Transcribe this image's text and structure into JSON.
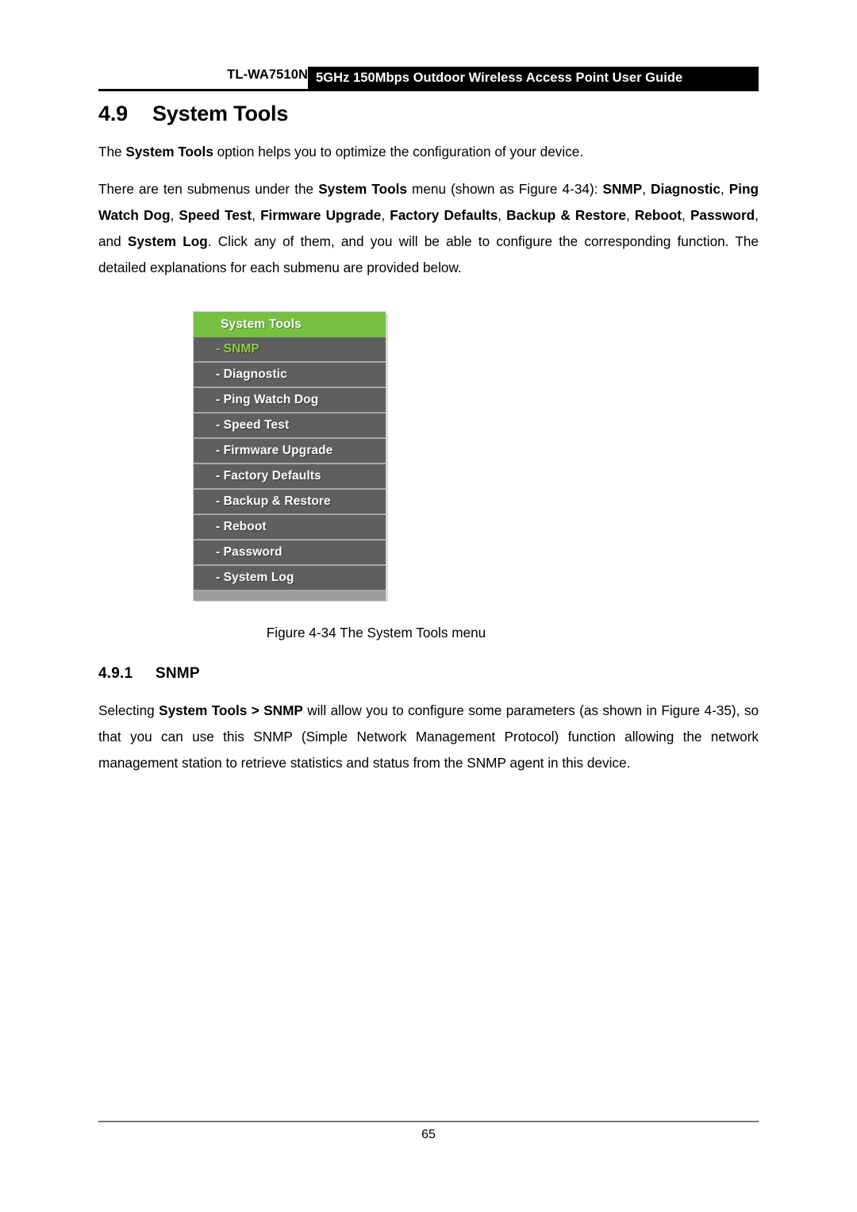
{
  "header": {
    "model": "TL-WA7510N",
    "title": "5GHz 150Mbps Outdoor Wireless Access Point User Guide"
  },
  "section": {
    "number": "4.9",
    "title": "System Tools"
  },
  "subsection": {
    "number": "4.9.1",
    "title": "SNMP"
  },
  "paragraphs": {
    "intro_1": "The ",
    "intro_1_bold": "System Tools",
    "intro_1_tail": " option helps you to optimize the configuration of your device.",
    "intro_2_a": "There are ten submenus under the ",
    "intro_2_b": "System Tools",
    "intro_2_c": " menu (shown as Figure 4-34): ",
    "intro_2_d": "SNMP",
    "intro_2_e": ", ",
    "intro_2_f": "Diagnostic",
    "intro_2_g": ", ",
    "intro_2_h": "Ping Watch Dog",
    "intro_2_i": ", ",
    "intro_2_j": "Speed Test",
    "intro_2_k": ", ",
    "intro_2_l": "Firmware Upgrade",
    "intro_2_m": ", ",
    "intro_2_n": "Factory Defaults",
    "intro_2_o": ", ",
    "intro_2_p": "Backup & Restore",
    "intro_2_q": ", ",
    "intro_2_r": "Reboot",
    "intro_2_s": ", ",
    "intro_2_t": "Password",
    "intro_2_u": ", and ",
    "intro_2_v": "System Log",
    "intro_2_w": ". Click any of them, and you will be able to configure the corresponding function. The detailed explanations for each submenu are provided below.",
    "snmp_a": "Selecting ",
    "snmp_b": "System Tools > SNMP",
    "snmp_c": " will allow you to configure some parameters (as shown in Figure 4-35), so that you can use this SNMP (Simple Network Management Protocol) function allowing the network management station to retrieve statistics and status from the SNMP agent in this device."
  },
  "figure": {
    "caption": "Figure 4-34 The System Tools menu",
    "menu": {
      "header_label": "System Tools",
      "header_color": "#77C043",
      "item_bg_color": "#5F5F5F",
      "active_text_color": "#8ECF3F",
      "items": [
        {
          "label": "- SNMP",
          "active": true
        },
        {
          "label": "- Diagnostic",
          "active": false
        },
        {
          "label": "- Ping Watch Dog",
          "active": false
        },
        {
          "label": "- Speed Test",
          "active": false
        },
        {
          "label": "- Firmware Upgrade",
          "active": false
        },
        {
          "label": "- Factory Defaults",
          "active": false
        },
        {
          "label": "- Backup & Restore",
          "active": false
        },
        {
          "label": "- Reboot",
          "active": false
        },
        {
          "label": "- Password",
          "active": false
        },
        {
          "label": "- System Log",
          "active": false
        }
      ]
    }
  },
  "footer": {
    "page_number": "65"
  }
}
